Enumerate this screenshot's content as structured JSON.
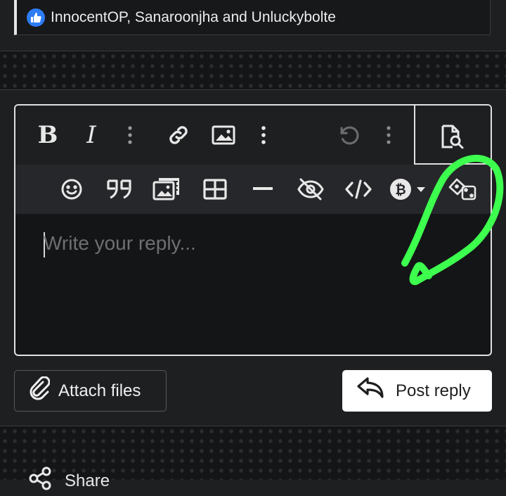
{
  "reactions": {
    "text": "InnocentOP, Sanaroonjha and Unluckybolte"
  },
  "toolbar": {
    "row1": [
      "bold-icon",
      "italic-icon",
      "more-icon",
      "link-icon",
      "image-icon",
      "more-icon",
      "undo-icon",
      "more-icon",
      "preview-icon"
    ],
    "row2": [
      "smile-icon",
      "quote-icon",
      "media-gallery-icon",
      "table-icon",
      "horizontal-rule-icon",
      "eye-off-icon",
      "code-icon",
      "bitcoin-icon",
      "dice-icon"
    ],
    "bold_glyph": "B",
    "italic_glyph": "I"
  },
  "editor": {
    "placeholder": "Write your reply..."
  },
  "actions": {
    "attach_label": "Attach files",
    "post_label": "Post reply"
  },
  "footer": {
    "share_label": "Share"
  },
  "colors": {
    "background": "#1e1f21",
    "like_badge": "#2d7cf5",
    "annotation": "#3dff4e",
    "placeholder": "#6e6f72"
  }
}
